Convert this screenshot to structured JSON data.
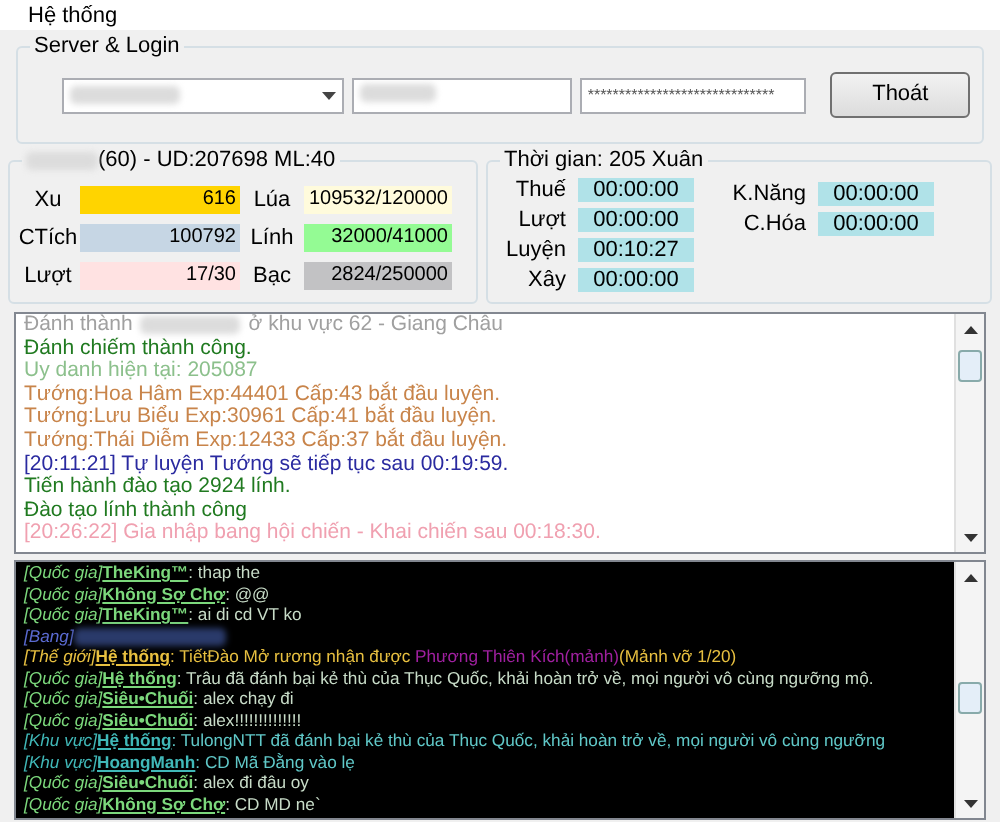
{
  "menu": [
    "Hệ thống"
  ],
  "login": {
    "title": "Server & Login",
    "password": "******************************",
    "button": "Thoát"
  },
  "character": {
    "title": "(60) - UD:207698 ML:40",
    "stats": [
      {
        "label": "Xu",
        "value": "616",
        "color": "#ffd400"
      },
      {
        "label": "Lúa",
        "value": "109532/120000",
        "color": "#fffbdc"
      },
      {
        "label": "CTích",
        "value": "100792",
        "color": "#c6d6e4"
      },
      {
        "label": "Lính",
        "value": "32000/41000",
        "color": "#94fb94"
      },
      {
        "label": "Lượt",
        "value": "17/30",
        "color": "#ffe2e2"
      },
      {
        "label": "Bạc",
        "value": "2824/250000",
        "color": "#c2c2c4"
      }
    ]
  },
  "time": {
    "title": "Thời gian: 205 Xuân",
    "left": [
      {
        "label": "Thuế",
        "value": "00:00:00"
      },
      {
        "label": "Lượt",
        "value": "00:00:00"
      },
      {
        "label": "Luyện",
        "value": "00:10:27"
      },
      {
        "label": "Xây",
        "value": "00:00:00"
      }
    ],
    "right": [
      {
        "label": "K.Năng",
        "value": "00:00:00"
      },
      {
        "label": "C.Hóa",
        "value": "00:00:00"
      }
    ]
  },
  "log": [
    {
      "text": "Đánh thành",
      "text_after": "ở khu vực 62 - Giang Châu",
      "redacted": true,
      "color": "#a0a0a0"
    },
    {
      "text": "Đánh chiếm thành công.",
      "color": "#207a20"
    },
    {
      "text": "Uy danh hiện tại: 205087",
      "color": "#8cc08c"
    },
    {
      "text": "Tướng:Hoa Hâm  Exp:44401 Cấp:43 bắt đầu luyện.",
      "color": "#c8844a"
    },
    {
      "text": "Tướng:Lưu Biểu  Exp:30961 Cấp:41 bắt đầu luyện.",
      "color": "#c8844a"
    },
    {
      "text": "Tướng:Thái Diễm  Exp:12433 Cấp:37 bắt đầu luyện.",
      "color": "#c8844a"
    },
    {
      "text": "[20:11:21] Tự luyện Tướng sẽ tiếp tục sau 00:19:59.",
      "color": "#2a2aa0"
    },
    {
      "text": "Tiến hành đào tạo 2924 lính.",
      "color": "#207a20"
    },
    {
      "text": "Đào tạo lính thành công",
      "color": "#207a20"
    },
    {
      "text": "[20:26:22] Gia nhập bang hội chiến - Khai chiến sau 00:18:30.",
      "color": "#f0a0b0"
    }
  ],
  "chat": [
    {
      "channel": "[Quốc gia]",
      "name": "TheKing™",
      "message": [
        {
          "text": ": thap the",
          "color": "#c8dcc8"
        }
      ],
      "color": "#7cd87c"
    },
    {
      "channel": "[Quốc gia]",
      "name": "Không Sợ Chợ",
      "message": [
        {
          "text": ": @@",
          "color": "#c8dcc8"
        }
      ],
      "color": "#7cd87c"
    },
    {
      "channel": "[Quốc gia]",
      "name": "TheKing™",
      "message": [
        {
          "text": ": ai di cd VT ko",
          "color": "#c8dcc8"
        }
      ],
      "color": "#7cd87c"
    },
    {
      "channel": "[Bang]",
      "redacted": true,
      "color": "#5a6ad0"
    },
    {
      "channel": "[Thế giới]",
      "name": "Hệ thống",
      "message": [
        {
          "text": ": TiếtĐào Mở rương nhận được ",
          "color": "#e8c040"
        },
        {
          "text": "Phương Thiên Kích(mảnh)",
          "color": "#a020a0"
        },
        {
          "text": "(Mảnh vỡ 1/20)",
          "color": "#e8c040"
        }
      ],
      "color": "#e8c040"
    },
    {
      "channel": "[Quốc gia]",
      "name": "Hệ thống",
      "message": [
        {
          "text": ": Trâu đã đánh bại kẻ thù của Thục Quốc, khải hoàn trở về, mọi người vô cùng ngưỡng mộ.",
          "color": "#c8dcc8"
        }
      ],
      "color": "#7cd87c"
    },
    {
      "channel": "[Quốc gia]",
      "name": "Siêu•Chuối",
      "message": [
        {
          "text": ": alex chạy đi",
          "color": "#c8dcc8"
        }
      ],
      "color": "#7cd87c"
    },
    {
      "channel": "[Quốc gia]",
      "name": "Siêu•Chuối",
      "message": [
        {
          "text": ": alex!!!!!!!!!!!!!!",
          "color": "#c8dcc8"
        }
      ],
      "color": "#7cd87c"
    },
    {
      "channel": "[Khu vực]",
      "name": "Hệ thống",
      "message": [
        {
          "text": ": TulongNTT đã đánh bại kẻ thù của Thục Quốc, khải hoàn trở về, mọi người vô cùng ngưỡng",
          "color": "#60c8c8"
        }
      ],
      "color": "#40b8b8"
    },
    {
      "channel": "[Khu vực]",
      "name": "HoangManh",
      "message": [
        {
          "text": ": CD Mã Đằng vào lẹ",
          "color": "#60c8c8"
        }
      ],
      "color": "#40b8b8"
    },
    {
      "channel": "[Quốc gia]",
      "name": "Siêu•Chuối",
      "message": [
        {
          "text": ": alex đi đâu oy",
          "color": "#c8dcc8"
        }
      ],
      "color": "#7cd87c"
    },
    {
      "channel": "[Quốc gia]",
      "name": "Không Sợ Chợ",
      "message": [
        {
          "text": ": CD MD ne`",
          "color": "#c8dcc8"
        }
      ],
      "color": "#7cd87c"
    }
  ]
}
